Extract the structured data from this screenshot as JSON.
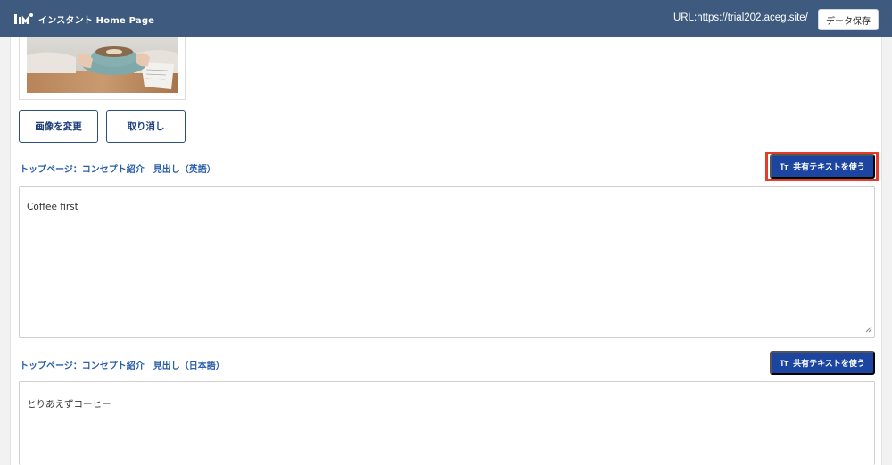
{
  "header": {
    "logo_text": "インスタント Home Page",
    "url_text": "URL:https://trial202.aceg.site/",
    "save_label": "データ保存"
  },
  "image_actions": {
    "change_label": "画像を変更",
    "cancel_label": "取り消し"
  },
  "fields": [
    {
      "label": "トップページ：コンセプト紹介　見出し（英語）",
      "shared_button_label": "共有テキストを使う",
      "shared_button_icon": "Tт",
      "value": "Coffee first"
    },
    {
      "label": "トップページ：コンセプト紹介　見出し（日本語）",
      "shared_button_label": "共有テキストを使う",
      "shared_button_icon": "Tт",
      "value": "とりあえずコーヒー"
    }
  ],
  "colors": {
    "header_bg": "#3e5a7e",
    "primary": "#1b45a0",
    "label": "#2a5ea8",
    "highlight": "#e53b2b"
  }
}
